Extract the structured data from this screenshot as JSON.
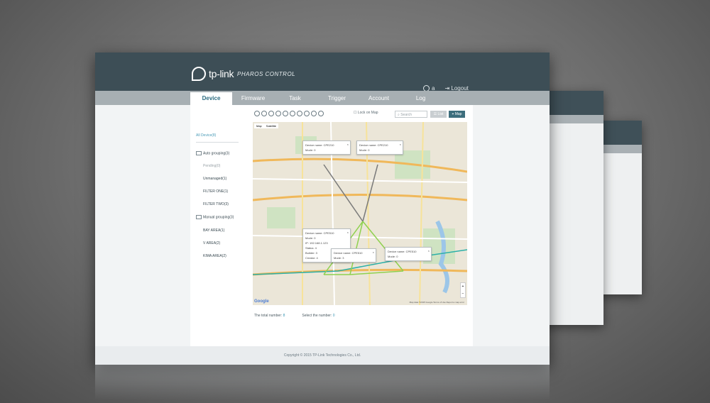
{
  "header": {
    "brand": "tp-link",
    "product": "PHAROS CONTROL",
    "user": "a",
    "logout": "Logout"
  },
  "tabs": [
    {
      "label": "Device"
    },
    {
      "label": "Firmware"
    },
    {
      "label": "Task"
    },
    {
      "label": "Trigger"
    },
    {
      "label": "Account"
    },
    {
      "label": "Log"
    }
  ],
  "sidebar": {
    "items": [
      {
        "label": "All Device(8)"
      },
      {
        "label": "Auto grouping(3)"
      },
      {
        "label": "Pending(0)"
      },
      {
        "label": "Unmanaged(1)"
      },
      {
        "label": "FILTER ONE(1)"
      },
      {
        "label": "FILTER TWO(3)"
      },
      {
        "label": "Manual grouping(3)"
      },
      {
        "label": "BAY AREA(1)"
      },
      {
        "label": "V AREA(2)"
      },
      {
        "label": "KIMA AREA(2)"
      }
    ]
  },
  "toolbar": {
    "lock_label": "Lock on Map",
    "search_placeholder": "Search",
    "list_label": "List",
    "map_label": "Map"
  },
  "map": {
    "type_options": [
      "Map",
      "Satellite"
    ],
    "popups": [
      {
        "lines": [
          "Device name: CPE210",
          "Mode: 0"
        ]
      },
      {
        "lines": [
          "Device name: CPE210",
          "Mode: 0"
        ]
      },
      {
        "lines": [
          "Device name: CPE510",
          "Mode: 0",
          "IP: 192.168.1.123",
          "Status: 4",
          "Builder: 3",
          "Creator: 4"
        ]
      },
      {
        "lines": [
          "Device name: CPE510",
          "Mode: 3"
        ]
      },
      {
        "lines": [
          "Device name: CPE510",
          "Mode: 0"
        ]
      }
    ],
    "google": "Google",
    "attribution": "Map data ©2015 Google   Terms of Use   Report a map error"
  },
  "footer": {
    "total_label": "The total number:",
    "total_value": "8",
    "select_label": "Select the number:",
    "select_value": "0"
  },
  "copyright": "Copyright © 2015 TP-Link Technologies Co., Ltd.",
  "colors": {
    "header": "#3d4e56",
    "accent": "#2d6d82",
    "map_button": "#3d6e7d"
  }
}
